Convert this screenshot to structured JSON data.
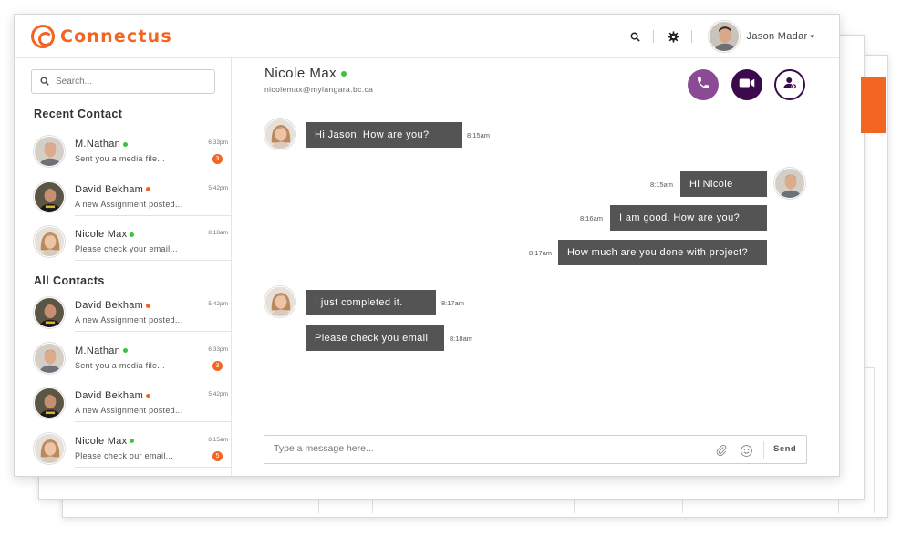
{
  "app": {
    "title": "Connectus"
  },
  "header": {
    "user_name": "Jason Madar",
    "caret": "▾",
    "search_icon": "search-icon",
    "settings_icon": "gear-icon"
  },
  "sidebar": {
    "search_placeholder": "Search...",
    "recent_title": "Recent Contact",
    "all_title": "All Contacts",
    "recent": [
      {
        "name": "M.Nathan",
        "status": "green",
        "message": "Sent you a media file...",
        "time": "6:33pm",
        "badge": "3",
        "avatar": "male-light"
      },
      {
        "name": "David Bekham",
        "status": "orange",
        "message": "A new Assignment posted...",
        "time": "5:42pm",
        "badge": "",
        "avatar": "male-dark"
      },
      {
        "name": "Nicole Max",
        "status": "green",
        "message": "Please check your email...",
        "time": "8:18am",
        "badge": "",
        "avatar": "female"
      }
    ],
    "all": [
      {
        "name": "David Bekham",
        "status": "orange",
        "message": "A new Assignment posted...",
        "time": "5:42pm",
        "badge": "",
        "avatar": "male-dark"
      },
      {
        "name": "M.Nathan",
        "status": "green",
        "message": "Sent you a media file...",
        "time": "6:33pm",
        "badge": "3",
        "avatar": "male-light"
      },
      {
        "name": "David Bekham",
        "status": "orange",
        "message": "A new Assignment posted...",
        "time": "5:42pm",
        "badge": "",
        "avatar": "male-dark"
      },
      {
        "name": "Nicole Max",
        "status": "green",
        "message": "Please check our email...",
        "time": "8:15am",
        "badge": "5",
        "avatar": "female"
      }
    ]
  },
  "chat": {
    "contact_name": "Nicole Max",
    "contact_email": "nicolemax@mylangara.bc.ca",
    "actions": {
      "call": "phone-icon",
      "video": "video-camera-icon",
      "add": "add-user-icon"
    },
    "messages": [
      {
        "from": "them",
        "text": "Hi Jason! How are you?",
        "time": "8:15am"
      },
      {
        "from": "me",
        "text": "Hi Nicole",
        "time": "8:15am"
      },
      {
        "from": "me",
        "text": "I am good. How are you?",
        "time": "8:16am"
      },
      {
        "from": "me",
        "text": "How much are you done with project?",
        "time": "8:17am"
      },
      {
        "from": "them",
        "text": "I just completed it.",
        "time": "8:17am"
      },
      {
        "from": "them",
        "text": "Please check you email",
        "time": "8:18am"
      }
    ],
    "composer_placeholder": "Type a message here...",
    "send_label": "Send"
  },
  "colors": {
    "brand": "#f26522",
    "call": "#8b4a95",
    "video": "#3b0a4d",
    "bubble": "#545454",
    "online": "#3cc23c"
  }
}
